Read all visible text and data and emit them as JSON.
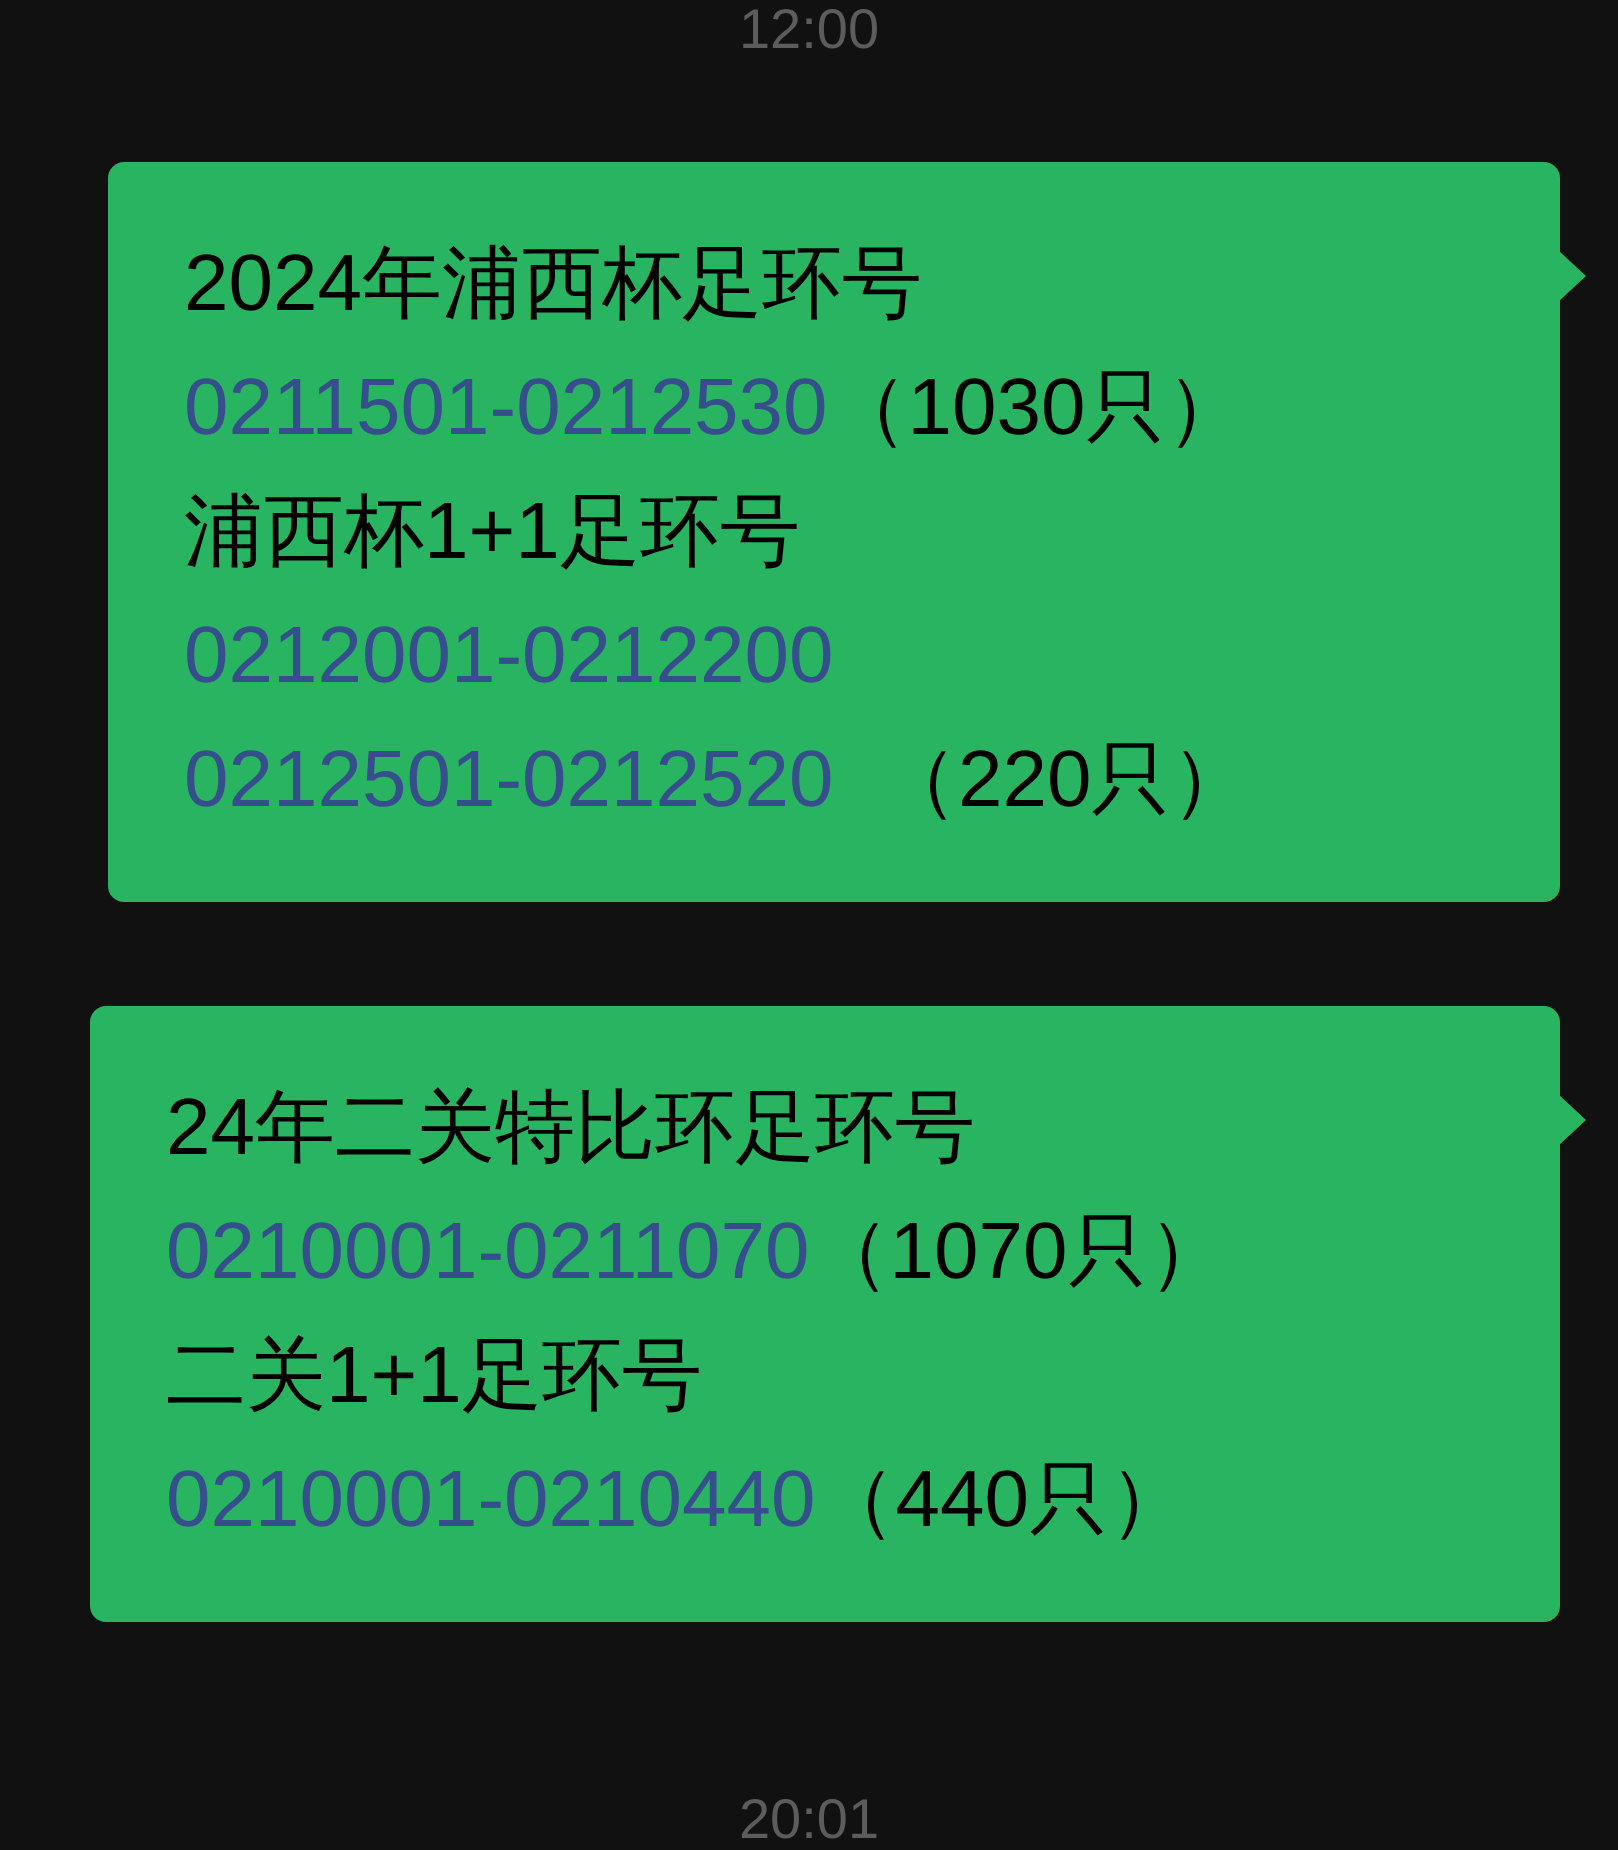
{
  "timestamps_top": "12:00",
  "messages": [
    {
      "lines": [
        [
          {
            "kind": "text",
            "text": "2024年浦西杯足环号"
          }
        ],
        [
          {
            "kind": "link",
            "text": "0211501-0212530"
          },
          {
            "kind": "text",
            "text": "（1030只）"
          }
        ],
        [
          {
            "kind": "text",
            "text": "浦西杯1+1足环号"
          }
        ],
        [
          {
            "kind": "link",
            "text": "0212001-0212200"
          }
        ],
        [
          {
            "kind": "link",
            "text": "0212501-0212520"
          },
          {
            "kind": "text",
            "text": "  （220只）"
          }
        ]
      ]
    },
    {
      "lines": [
        [
          {
            "kind": "text",
            "text": "24年二关特比环足环号"
          }
        ],
        [
          {
            "kind": "link",
            "text": "0210001-0211070"
          },
          {
            "kind": "text",
            "text": "（1070只）"
          }
        ],
        [
          {
            "kind": "text",
            "text": "二关1+1足环号"
          }
        ],
        [
          {
            "kind": "link",
            "text": "0210001-0210440"
          },
          {
            "kind": "text",
            "text": "（440只）"
          }
        ]
      ]
    }
  ],
  "timestamp_bottom": "20:01"
}
